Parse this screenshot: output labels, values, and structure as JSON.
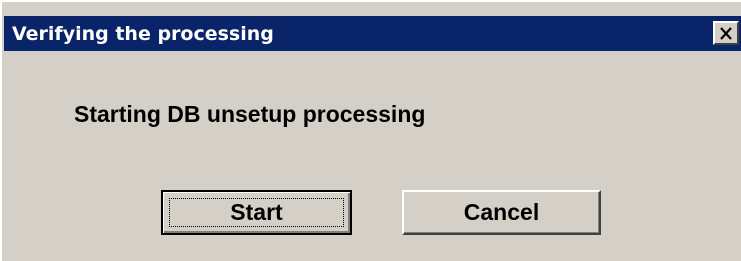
{
  "dialog": {
    "title": "Verifying the processing",
    "close_icon": "close-icon",
    "message": "Starting DB unsetup processing",
    "buttons": {
      "start_label": "Start",
      "cancel_label": "Cancel"
    }
  },
  "colors": {
    "titlebar": "#0a246a",
    "title_text": "#ffffff",
    "dialog_bg": "#d4d0c8",
    "text": "#000000"
  }
}
